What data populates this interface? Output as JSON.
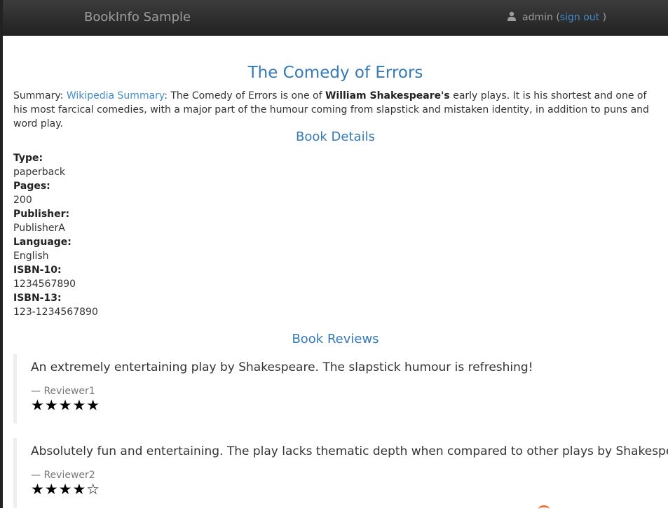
{
  "header": {
    "brand": "BookInfo Sample",
    "user": "admin",
    "open_paren": "(",
    "signout": "sign out",
    "close_paren": ")"
  },
  "book": {
    "title": "The Comedy of Errors",
    "summary_prefix": "Summary: ",
    "summary_link": "Wikipedia Summary",
    "summary_mid": ": The Comedy of Errors is one of ",
    "summary_bold": "William Shakespeare's",
    "summary_rest": " early plays. It is his shortest and one of his most farcical comedies, with a major part of the humour coming from slapstick and mistaken identity, in addition to puns and word play."
  },
  "details": {
    "heading": "Book Details",
    "items": [
      {
        "label": "Type:",
        "value": "paperback"
      },
      {
        "label": "Pages:",
        "value": "200"
      },
      {
        "label": "Publisher:",
        "value": "PublisherA"
      },
      {
        "label": "Language:",
        "value": "English"
      },
      {
        "label": "ISBN-10:",
        "value": "1234567890"
      },
      {
        "label": "ISBN-13:",
        "value": "123-1234567890"
      }
    ]
  },
  "reviews": {
    "heading": "Book Reviews",
    "items": [
      {
        "text": "An extremely entertaining play by Shakespeare. The slapstick humour is refreshing!",
        "author": "— Reviewer1",
        "rating": 5,
        "stars": "★★★★★"
      },
      {
        "text": "Absolutely fun and entertaining. The play lacks thematic depth when compared to other plays by Shakespeare.",
        "author": "— Reviewer2",
        "rating": 4,
        "stars": "★★★★☆"
      }
    ]
  }
}
